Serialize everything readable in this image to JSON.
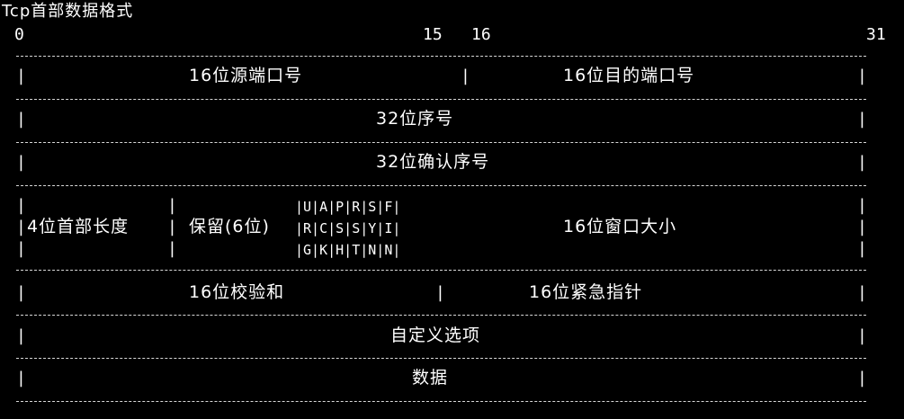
{
  "title": "Tcp首部数据格式",
  "bit_positions": {
    "start": "0",
    "b15": "15",
    "b16": "16",
    "end": "31"
  },
  "separator_char": "|",
  "rows": {
    "ports": {
      "source": "16位源端口号",
      "dest": "16位目的端口号"
    },
    "seq": "32位序号",
    "ack": "32位确认序号",
    "control": {
      "header_length": "4位首部长度",
      "reserved": "保留(6位)",
      "flags_row1": "|U|A|P|R|S|F|",
      "flags_row2": "|R|C|S|S|Y|I|",
      "flags_row3": "|G|K|H|T|N|N|",
      "window": "16位窗口大小"
    },
    "checksum_urgent": {
      "checksum": "16位校验和",
      "urgent": "16位紧急指针"
    },
    "options": "自定义选项",
    "data": "数据"
  }
}
